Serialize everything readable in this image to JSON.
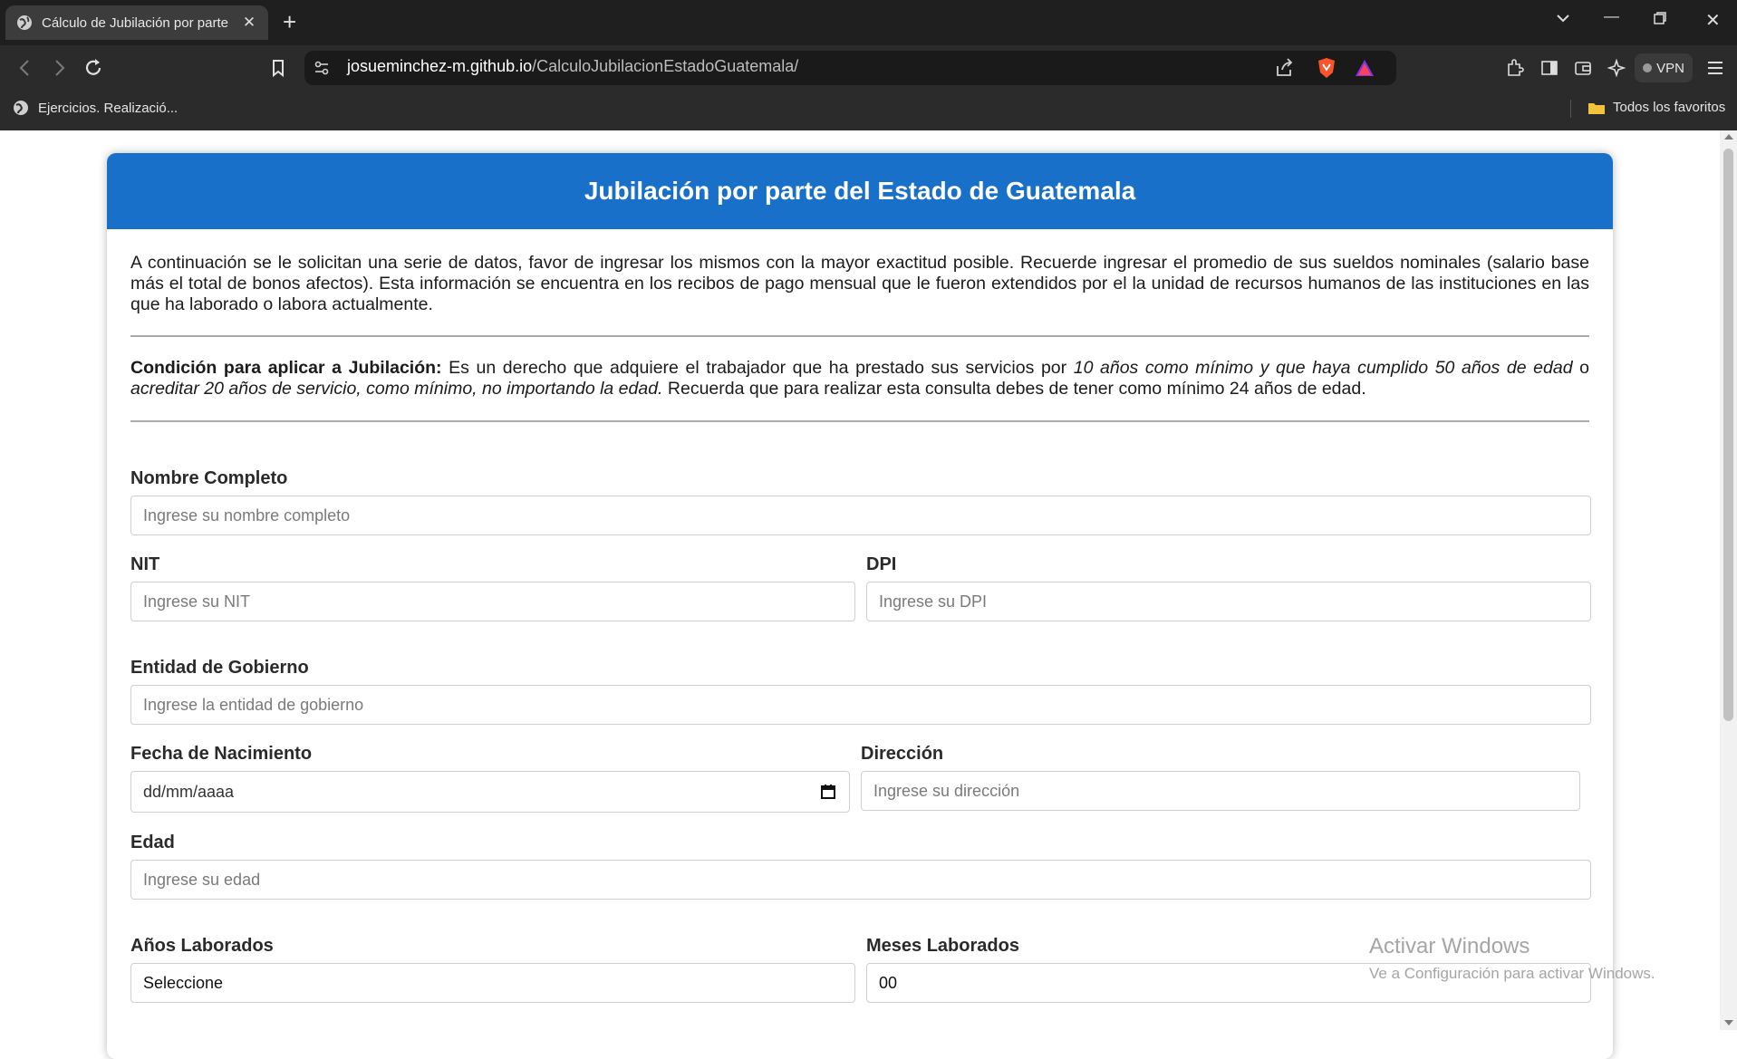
{
  "browser": {
    "tab_title": "Cálculo de Jubilación por parte",
    "url_host": "josueminchez-m.github.io",
    "url_path": "/CalculoJubilacionEstadoGuatemala/",
    "vpn_label": "VPN",
    "bookmark_left": "Ejercicios. Realizació...",
    "bookmark_right": "Todos los favoritos"
  },
  "header": {
    "title": "Jubilación por parte del Estado de Guatemala"
  },
  "intro": {
    "text": "A continuación se le solicitan una serie de datos, favor de ingresar los mismos con la mayor exactitud posible. Recuerde ingresar el promedio de sus sueldos nominales (salario base más el total de bonos afectos). Esta información se encuentra en los recibos de pago mensual que le fueron extendidos por el la unidad de recursos humanos de las instituciones en las que ha laborado o labora actualmente."
  },
  "condition": {
    "label": "Condición para aplicar a Jubilación:",
    "text1": " Es un derecho que adquiere el trabajador que ha prestado sus servicios por ",
    "italic1": "10 años como mínimo y que haya cumplido 50 años de edad",
    "text2": " o ",
    "italic2": "acreditar 20 años de servicio, como mínimo, no importando la edad.",
    "text3": " Recuerda que para realizar esta consulta debes de tener como mínimo 24 años de edad."
  },
  "form": {
    "nombre": {
      "label": "Nombre Completo",
      "placeholder": "Ingrese su nombre completo"
    },
    "nit": {
      "label": "NIT",
      "placeholder": "Ingrese su NIT"
    },
    "dpi": {
      "label": "DPI",
      "placeholder": "Ingrese su DPI"
    },
    "entidad": {
      "label": "Entidad de Gobierno",
      "placeholder": "Ingrese la entidad de gobierno"
    },
    "fecha": {
      "label": "Fecha de Nacimiento",
      "value": "dd/mm/aaaa"
    },
    "direccion": {
      "label": "Dirección",
      "placeholder": "Ingrese su dirección"
    },
    "edad": {
      "label": "Edad",
      "placeholder": "Ingrese su edad"
    },
    "anios": {
      "label": "Años Laborados",
      "value": "Seleccione"
    },
    "meses": {
      "label": "Meses Laborados",
      "value": "00"
    }
  },
  "watermark": {
    "line1": "Activar Windows",
    "line2": "Ve a Configuración para activar Windows."
  }
}
